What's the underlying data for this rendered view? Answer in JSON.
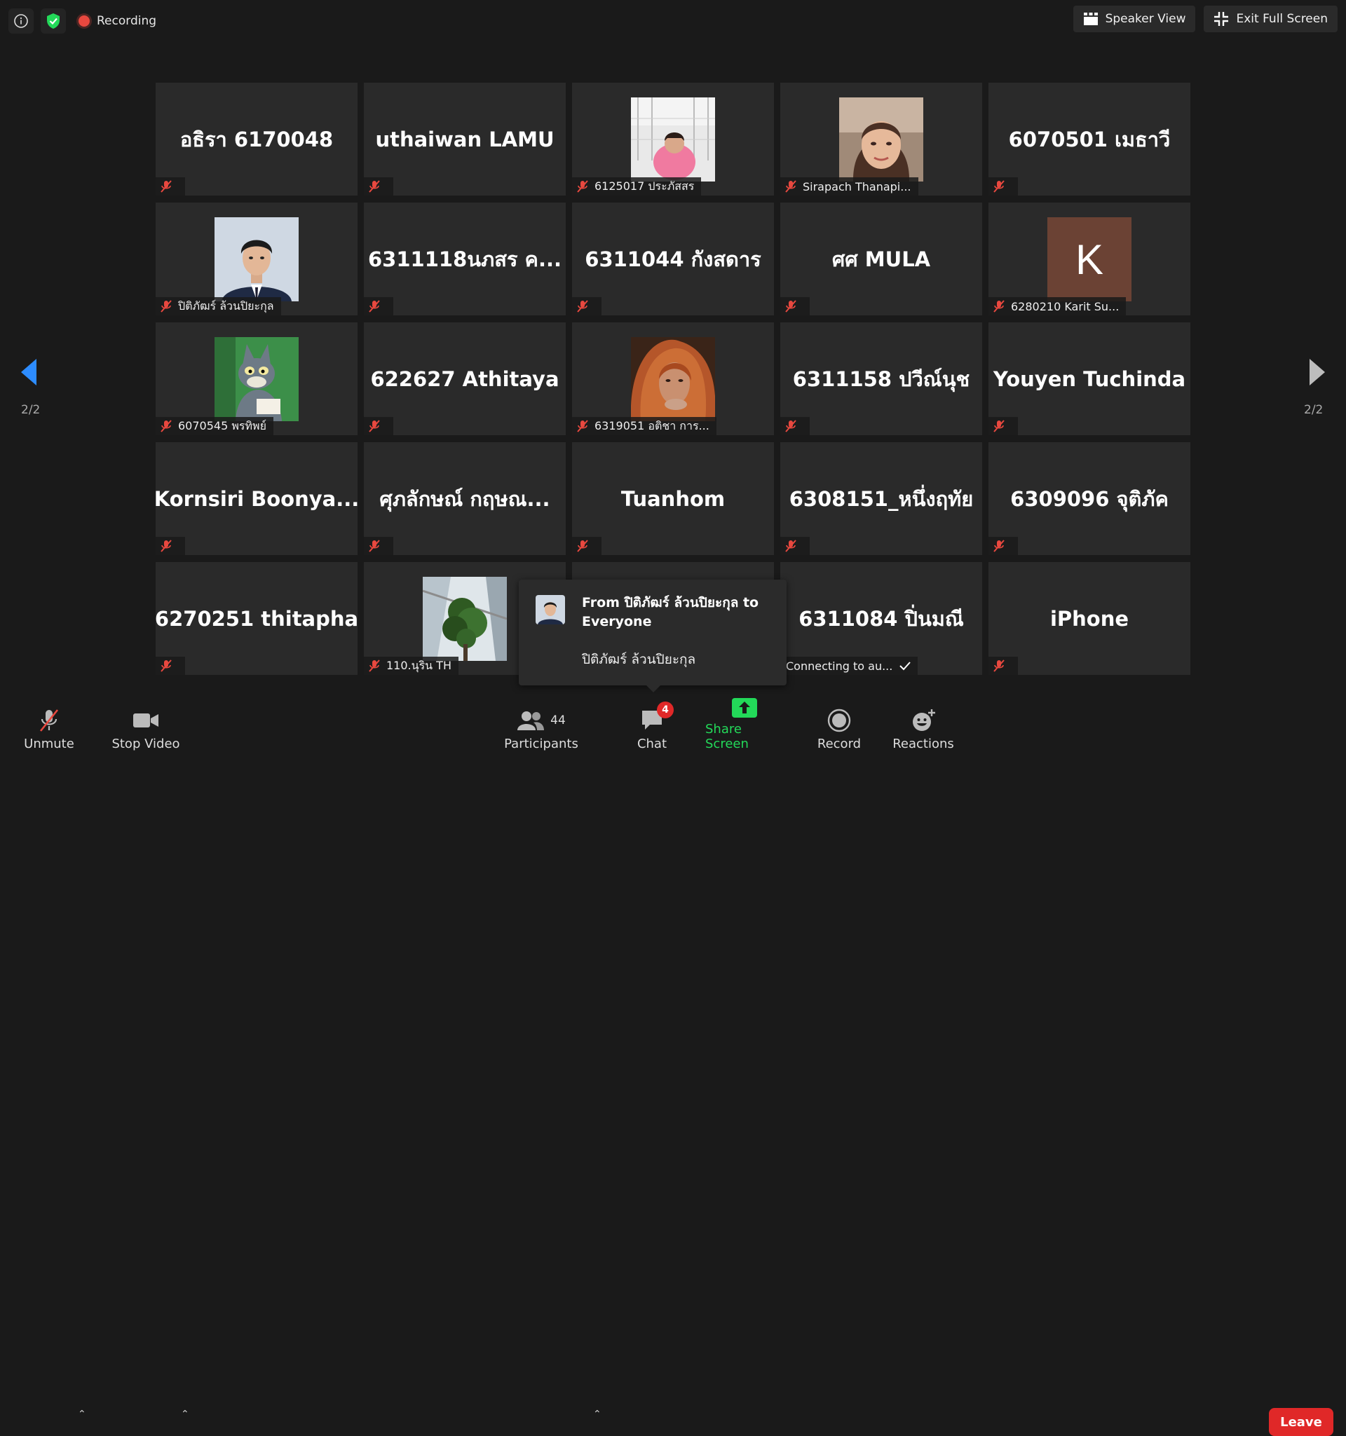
{
  "meeting": {
    "recording_label": "Recording",
    "speaker_view_label": "Speaker View",
    "exit_full_screen_label": "Exit Full Screen"
  },
  "gallery": {
    "page_indicator_left": "2/2",
    "page_indicator_right": "2/2",
    "tiles": [
      {
        "display_name": "อธิรา 6170048",
        "has_video": false,
        "label": ""
      },
      {
        "display_name": "uthaiwan LAMU",
        "has_video": false,
        "label": ""
      },
      {
        "display_name": "",
        "has_video": true,
        "label": "6125017 ประภัสสร"
      },
      {
        "display_name": "",
        "has_video": true,
        "label": "Sirapach Thanapi..."
      },
      {
        "display_name": "6070501 เมธาวี",
        "has_video": false,
        "label": ""
      },
      {
        "display_name": "",
        "has_video": true,
        "label": "ปิติภัฒร์ ล้วนปิยะกุล"
      },
      {
        "display_name": "6311118นภสร ค...",
        "has_video": false,
        "label": ""
      },
      {
        "display_name": "6311044 กังสดาร",
        "has_video": false,
        "label": ""
      },
      {
        "display_name": "ศศ MULA",
        "has_video": false,
        "label": ""
      },
      {
        "display_name": "",
        "has_video": true,
        "avatar_letter": "K",
        "label": "6280210 Karit Su..."
      },
      {
        "display_name": "",
        "has_video": true,
        "label": "6070545 พรทิพย์"
      },
      {
        "display_name": "622627 Athitaya",
        "has_video": false,
        "label": ""
      },
      {
        "display_name": "",
        "has_video": true,
        "label": "6319051 อติชา การ..."
      },
      {
        "display_name": "6311158 ปวีณ์นุช",
        "has_video": false,
        "label": ""
      },
      {
        "display_name": "Youyen Tuchinda",
        "has_video": false,
        "label": ""
      },
      {
        "display_name": "Kornsiri  Boonya...",
        "has_video": false,
        "label": ""
      },
      {
        "display_name": "ศุภลักษณ์ กฤษณ...",
        "has_video": false,
        "label": ""
      },
      {
        "display_name": "Tuanhom",
        "has_video": false,
        "label": ""
      },
      {
        "display_name": "6308151_หนึ่งฤทัย",
        "has_video": false,
        "label": ""
      },
      {
        "display_name": "6309096 จุติภัค",
        "has_video": false,
        "label": ""
      },
      {
        "display_name": "6270251 thitapha",
        "has_video": false,
        "label": ""
      },
      {
        "display_name": "",
        "has_video": true,
        "label": "110.นุริน TH"
      },
      {
        "display_name": "",
        "has_video": false,
        "label": ""
      },
      {
        "display_name": "6311084 ปิ่นมณี",
        "has_video": false,
        "label": "Connecting to au..."
      },
      {
        "display_name": "iPhone",
        "has_video": false,
        "label": ""
      }
    ]
  },
  "chat_popup": {
    "from": "From ปิติภัฒร์ ล้วนปิยะกุล to Everyone",
    "message": "ปิติภัฒร์ ล้วนปิยะกุล"
  },
  "toolbar": {
    "unmute_label": "Unmute",
    "stop_video_label": "Stop Video",
    "participants_label": "Participants",
    "participants_count": "44",
    "chat_label": "Chat",
    "chat_badge": "4",
    "share_screen_label": "Share Screen",
    "record_label": "Record",
    "reactions_label": "Reactions",
    "leave_label": "Leave"
  },
  "colors": {
    "background": "#1a1a1a",
    "tile": "#2a2a2a",
    "share_green": "#23d959",
    "mute_red": "#e8483f",
    "leave_red": "#e02828",
    "nav_blue": "#2d8cff"
  }
}
